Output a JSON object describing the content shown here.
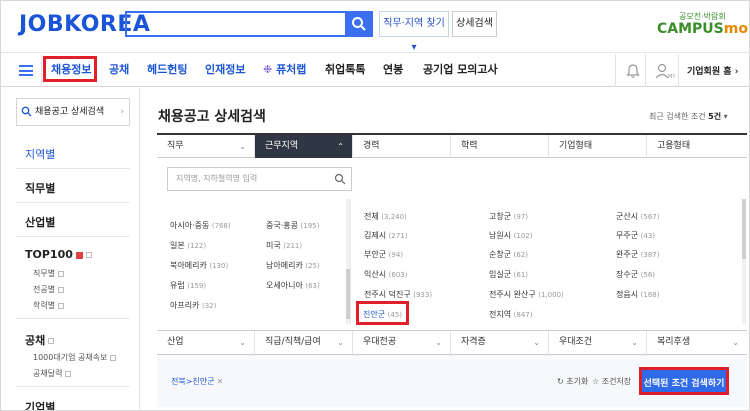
{
  "header": {
    "logo": "JOBKOREA",
    "search_value": "",
    "jobloc_btn": "직무·지역 찾기 ▾",
    "detail_btn": "상세검색",
    "campus_sub": "공모전·박람회",
    "campus_logo_a": "CAMPUS",
    "campus_logo_b": "mon"
  },
  "nav": {
    "items": [
      "채용정보",
      "공채",
      "헤드헌팅",
      "인재정보",
      "퓨처랩",
      "취업톡톡",
      "연봉",
      "공기업 모의고사"
    ],
    "corp_home": "기업회원 홈",
    "corp_chev": "›",
    "user_label": "MY"
  },
  "sidebar": {
    "search_label": "채용공고 상세검색",
    "search_chev": "›",
    "items": [
      "지역별",
      "직무별",
      "산업별",
      "TOP100",
      "공채",
      "기업별"
    ],
    "top100_subs": [
      "직무별",
      "전공별",
      "학력별"
    ],
    "gongchae_subs": [
      "1000대기업 공채속보",
      "공채달력"
    ]
  },
  "main": {
    "title": "채용공고 상세검색",
    "recent_prefix": "최근 검색한 조건 ",
    "recent_count": "5건",
    "recent_arrow": "▾",
    "tabs": [
      "직무",
      "근무지역",
      "경력",
      "학력",
      "기업형태",
      "고용형태"
    ],
    "tab_arrows": [
      "⌄",
      "⌃"
    ],
    "loc_placeholder": "지역명, 지하철역명 입력",
    "left_list": [
      {
        "name": "아시아·중동",
        "count": "(768)"
      },
      {
        "name": "중국·홍콩",
        "count": "(195)"
      },
      {
        "name": "일본",
        "count": "(122)"
      },
      {
        "name": "미국",
        "count": "(211)"
      },
      {
        "name": "북아메리카",
        "count": "(130)"
      },
      {
        "name": "남아메리카",
        "count": "(25)"
      },
      {
        "name": "유럽",
        "count": "(159)"
      },
      {
        "name": "오세아니아",
        "count": "(63)"
      },
      {
        "name": "아프리카",
        "count": "(32)"
      }
    ],
    "right_list": [
      {
        "name": "전체",
        "count": "(3,240)"
      },
      {
        "name": "고창군",
        "count": "(97)"
      },
      {
        "name": "군산시",
        "count": "(567)"
      },
      {
        "name": "김제시",
        "count": "(271)"
      },
      {
        "name": "남원시",
        "count": "(102)"
      },
      {
        "name": "무주군",
        "count": "(43)"
      },
      {
        "name": "부안군",
        "count": "(94)"
      },
      {
        "name": "순창군",
        "count": "(62)"
      },
      {
        "name": "완주군",
        "count": "(387)"
      },
      {
        "name": "익산시",
        "count": "(603)"
      },
      {
        "name": "임실군",
        "count": "(61)"
      },
      {
        "name": "장수군",
        "count": "(56)"
      },
      {
        "name": "전주시 덕진구",
        "count": "(933)"
      },
      {
        "name": "전주시 완산구",
        "count": "(1,000)"
      },
      {
        "name": "정읍시",
        "count": "(168)"
      },
      {
        "name": "진안군",
        "count": "(45)"
      },
      {
        "name": "전지역",
        "count": "(847)"
      }
    ],
    "tabs2": [
      "산업",
      "직급/직책/급여",
      "우대전공",
      "자격증",
      "우대조건",
      "복리후생"
    ],
    "selected_tag": "전북>진안군",
    "tag_close": "✕",
    "reset": "↻ 초기화",
    "save": "☆ 조건저장",
    "go": "선택된 조건 검색하기"
  }
}
